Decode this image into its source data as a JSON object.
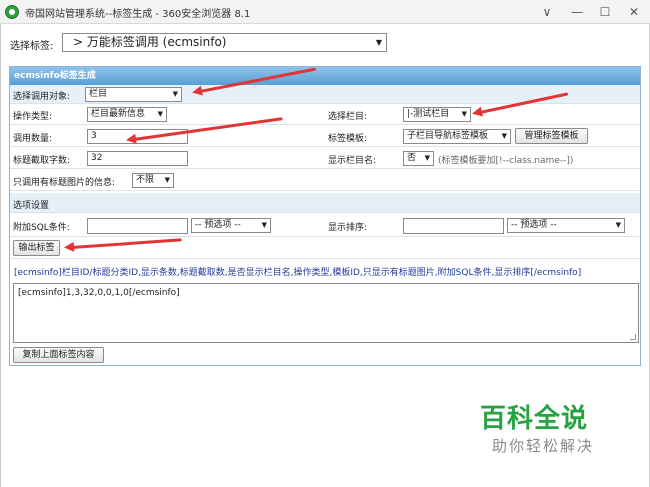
{
  "window": {
    "title": "帝国网站管理系统--标签生成 - 360安全浏览器 8.1",
    "controls": {
      "restore": "∨",
      "minimize": "—",
      "maximize": "☐",
      "close": "✕"
    }
  },
  "top": {
    "select_label": "选择标签:",
    "select_value": "> 万能标签调用 (ecmsinfo)"
  },
  "panel": {
    "header": "ecmsinfo标签生成",
    "call_object_label": "选择调用对象:",
    "call_object_value": "栏目",
    "op_type_label": "操作类型:",
    "op_type_value": "栏目最新信息",
    "column_label": "选择栏目:",
    "column_value": "|-测试栏目",
    "count_label": "调用数量:",
    "count_value": "3",
    "template_label": "标签模板:",
    "template_value": "子栏目导航标签模板",
    "manage_template_button": "管理标签模板",
    "title_cut_label": "标题截取字数:",
    "title_cut_value": "32",
    "show_col_label": "显示栏目名:",
    "show_col_value": "否",
    "show_col_hint": "(标签模板要加[!--class.name--])",
    "only_img_label": "只调用有标题图片的信息:",
    "only_img_value": "不限",
    "options_header": "选项设置",
    "sql_label": "附加SQL条件:",
    "sql_value": "",
    "sql_preset": "-- 预选项 --",
    "order_label": "显示排序:",
    "order_value": "",
    "order_preset": "-- 预选项 --",
    "output_button": "输出标签",
    "syntax_line": "[ecmsinfo]栏目ID/标题分类ID,显示条数,标题截取数,是否显示栏目名,操作类型,模板ID,只显示有标题图片,附加SQL条件,显示排序[/ecmsinfo]",
    "output_text": "[ecmsinfo]1,3,32,0,0,1,0[/ecmsinfo]",
    "copy_button": "复制上面标签内容"
  },
  "watermark": {
    "main": "百科全说",
    "sub": "助你轻松解决"
  },
  "colors": {
    "accent_arrow": "#e23434",
    "header_blue": "#5a9fd5",
    "watermark_green": "#27a243"
  }
}
